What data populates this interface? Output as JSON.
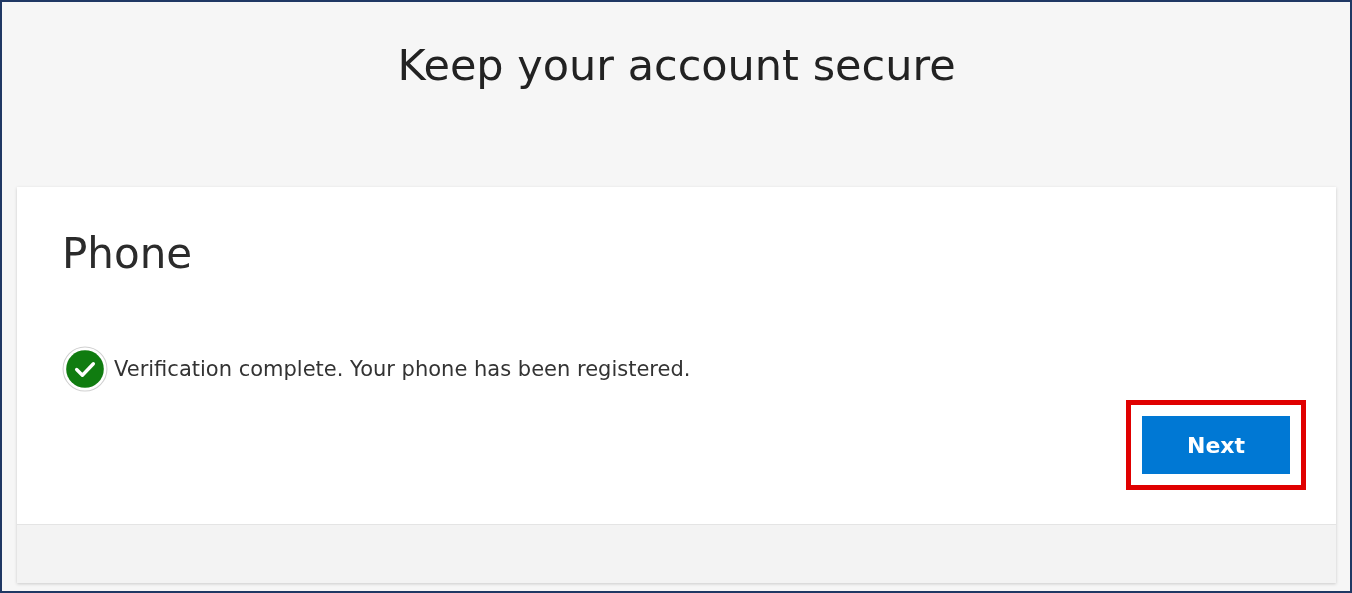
{
  "page": {
    "title": "Keep your account secure"
  },
  "card": {
    "heading": "Phone",
    "status": {
      "kind": "success",
      "message": "Verification complete. Your phone has been registered."
    },
    "button": {
      "label": "Next",
      "highlighted": true
    }
  }
}
